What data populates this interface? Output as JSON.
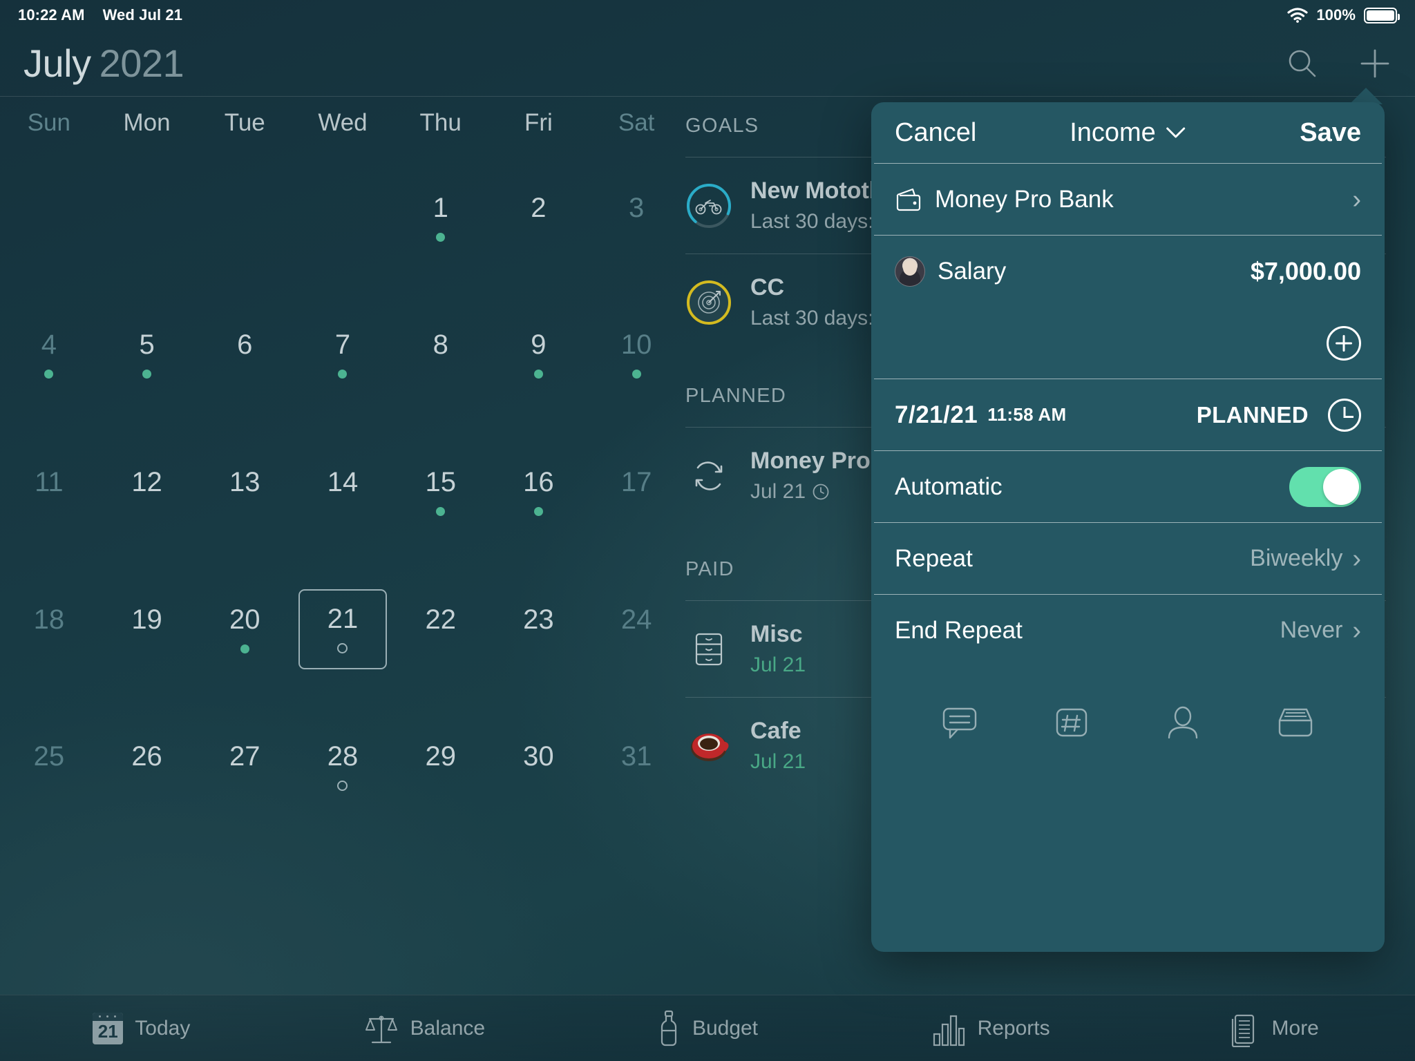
{
  "status_bar": {
    "time": "10:22 AM",
    "date": "Wed Jul 21",
    "battery_percent": "100%",
    "wifi_icon": "wifi-icon",
    "battery_icon": "battery-icon"
  },
  "header": {
    "month": "July",
    "year": "2021",
    "search_icon": "search-icon",
    "add_icon": "plus-icon"
  },
  "calendar": {
    "weekdays": [
      "Sun",
      "Mon",
      "Tue",
      "Wed",
      "Thu",
      "Fri",
      "Sat"
    ],
    "weeks": [
      [
        {
          "day": "",
          "mark": "none",
          "dim": false
        },
        {
          "day": "",
          "mark": "none",
          "dim": false
        },
        {
          "day": "",
          "mark": "none",
          "dim": false
        },
        {
          "day": "",
          "mark": "none",
          "dim": false
        },
        {
          "day": "1",
          "mark": "dot",
          "dim": false
        },
        {
          "day": "2",
          "mark": "none",
          "dim": false
        },
        {
          "day": "3",
          "mark": "none",
          "dim": true
        }
      ],
      [
        {
          "day": "4",
          "mark": "dot",
          "dim": true
        },
        {
          "day": "5",
          "mark": "dot",
          "dim": false
        },
        {
          "day": "6",
          "mark": "none",
          "dim": false
        },
        {
          "day": "7",
          "mark": "dot",
          "dim": false
        },
        {
          "day": "8",
          "mark": "none",
          "dim": false
        },
        {
          "day": "9",
          "mark": "dot",
          "dim": false
        },
        {
          "day": "10",
          "mark": "dot",
          "dim": true
        }
      ],
      [
        {
          "day": "11",
          "mark": "none",
          "dim": true
        },
        {
          "day": "12",
          "mark": "none",
          "dim": false
        },
        {
          "day": "13",
          "mark": "none",
          "dim": false
        },
        {
          "day": "14",
          "mark": "none",
          "dim": false
        },
        {
          "day": "15",
          "mark": "dot",
          "dim": false
        },
        {
          "day": "16",
          "mark": "dot",
          "dim": false
        },
        {
          "day": "17",
          "mark": "none",
          "dim": true
        }
      ],
      [
        {
          "day": "18",
          "mark": "none",
          "dim": true
        },
        {
          "day": "19",
          "mark": "none",
          "dim": false
        },
        {
          "day": "20",
          "mark": "dot",
          "dim": false
        },
        {
          "day": "21",
          "mark": "ring",
          "dim": false,
          "today": true
        },
        {
          "day": "22",
          "mark": "none",
          "dim": false
        },
        {
          "day": "23",
          "mark": "none",
          "dim": false
        },
        {
          "day": "24",
          "mark": "none",
          "dim": true
        }
      ],
      [
        {
          "day": "25",
          "mark": "none",
          "dim": true
        },
        {
          "day": "26",
          "mark": "none",
          "dim": false
        },
        {
          "day": "27",
          "mark": "none",
          "dim": false
        },
        {
          "day": "28",
          "mark": "ring",
          "dim": false
        },
        {
          "day": "29",
          "mark": "none",
          "dim": false
        },
        {
          "day": "30",
          "mark": "none",
          "dim": false
        },
        {
          "day": "31",
          "mark": "none",
          "dim": true
        }
      ],
      [
        {
          "day": "",
          "mark": "none",
          "dim": false
        },
        {
          "day": "",
          "mark": "none",
          "dim": false
        },
        {
          "day": "",
          "mark": "none",
          "dim": false
        },
        {
          "day": "",
          "mark": "none",
          "dim": false
        },
        {
          "day": "",
          "mark": "none",
          "dim": false
        },
        {
          "day": "",
          "mark": "none",
          "dim": false
        },
        {
          "day": "",
          "mark": "none",
          "dim": false
        }
      ]
    ],
    "selected_day": "21",
    "dot_color": "#4cb391"
  },
  "sidebar": {
    "goals_title": "GOALS",
    "planned_title": "PLANNED",
    "paid_title": "PAID",
    "goals": [
      {
        "name": "New Mototb",
        "sub": "Last 30 days:",
        "icon": "motorbike-icon",
        "ring_color": "#2aacc8"
      },
      {
        "name": "CC",
        "sub": "Last 30 days:",
        "icon": "target-icon",
        "ring_color": "#d4bb20"
      }
    ],
    "planned": [
      {
        "name": "Money Pro Ba",
        "sub": "Jul 21",
        "icon": "repeat-icon",
        "has_clock": true
      }
    ],
    "paid": [
      {
        "name": "Misc",
        "sub": "Jul 21",
        "icon": "drawers-icon"
      },
      {
        "name": "Cafe",
        "sub": "Jul 21",
        "icon": "coffee-cup-icon"
      }
    ]
  },
  "modal": {
    "cancel_label": "Cancel",
    "type_label": "Income",
    "type_chevron_icon": "chevron-down-icon",
    "save_label": "Save",
    "account": {
      "name": "Money Pro Bank",
      "icon": "wallet-icon",
      "chevron_icon": "chevron-right-icon"
    },
    "category": {
      "name": "Salary",
      "amount": "$7,000.00",
      "icon": "person-avatar"
    },
    "add_button_icon": "circle-plus-icon",
    "schedule": {
      "date": "7/21/21",
      "time": "11:58 AM",
      "status": "PLANNED",
      "status_icon": "clock-icon"
    },
    "automatic": {
      "label": "Automatic",
      "value": "on",
      "toggle_color": "#62e0ad"
    },
    "repeat": {
      "label": "Repeat",
      "value": "Biweekly",
      "chevron_icon": "chevron-right-icon"
    },
    "end_repeat": {
      "label": "End Repeat",
      "value": "Never",
      "chevron_icon": "chevron-right-icon"
    },
    "footer_icons": [
      {
        "name": "comment-icon"
      },
      {
        "name": "hashtag-icon"
      },
      {
        "name": "person-icon"
      },
      {
        "name": "archive-icon"
      }
    ]
  },
  "tabbar": {
    "items": [
      {
        "label": "Today",
        "icon": "calendar-icon",
        "active": true
      },
      {
        "label": "Balance",
        "icon": "scales-icon",
        "active": false
      },
      {
        "label": "Budget",
        "icon": "bottle-icon",
        "active": false
      },
      {
        "label": "Reports",
        "icon": "bar-chart-icon",
        "active": false
      },
      {
        "label": "More",
        "icon": "documents-icon",
        "active": false
      }
    ],
    "today_badge_day": "21"
  }
}
